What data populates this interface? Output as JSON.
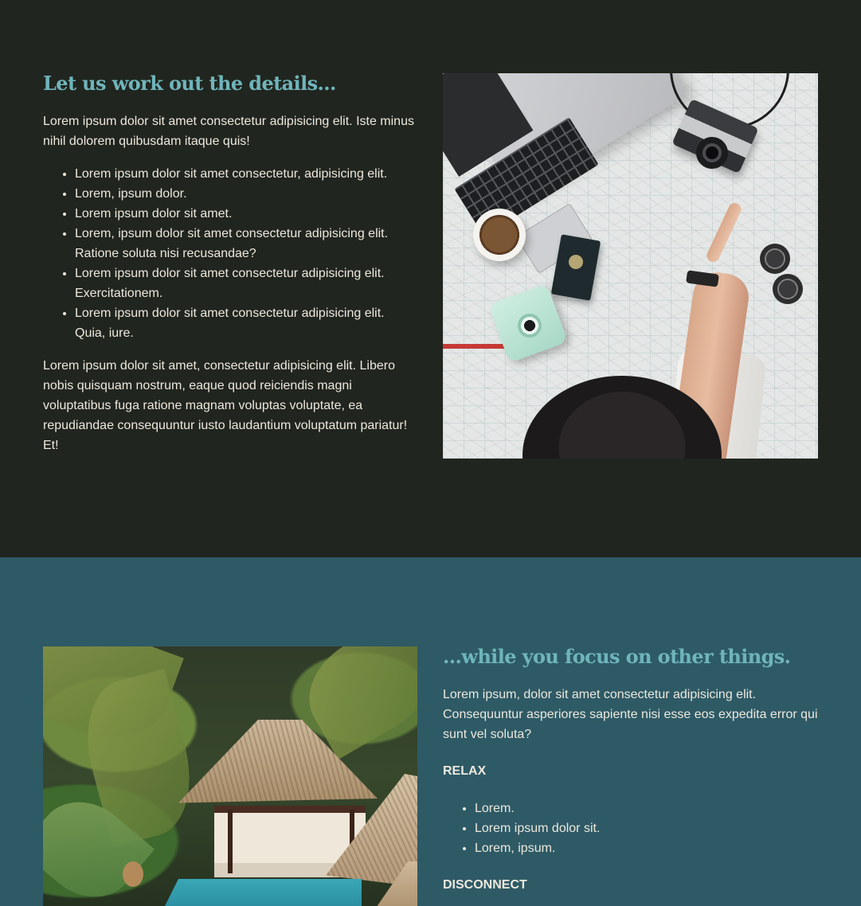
{
  "section_one": {
    "heading": "Let us work out the details...",
    "intro": "Lorem ipsum dolor sit amet consectetur adipisicing elit. Iste minus nihil dolorem quibusdam itaque quis!",
    "list": [
      "Lorem ipsum dolor sit amet consectetur, adipisicing elit.",
      "Lorem, ipsum dolor.",
      "Lorem ipsum dolor sit amet.",
      "Lorem, ipsum dolor sit amet consectetur adipisicing elit. Ratione soluta nisi recusandae?",
      "Lorem ipsum dolor sit amet consectetur adipisicing elit. Exercitationem.",
      "Lorem ipsum dolor sit amet consectetur adipisicing elit. Quia, iure."
    ],
    "outro": "Lorem ipsum dolor sit amet, consectetur adipisicing elit. Libero nobis quisquam nostrum, eaque quod reiciendis magni voluptatibus fuga ratione magnam voluptas voluptate, ea repudiandae consequuntur iusto laudantium voluptatum pariatur! Et!"
  },
  "section_two": {
    "heading": "...while you focus on other things.",
    "intro": "Lorem ipsum, dolor sit amet consectetur adipisicing elit. Consequuntur asperiores sapiente nisi esse eos expedita error qui sunt vel soluta?",
    "relax_label": "RELAX",
    "relax_list": [
      "Lorem.",
      "Lorem ipsum dolor sit.",
      "Lorem, ipsum."
    ],
    "disconnect_label": "DISCONNECT"
  },
  "colors": {
    "dark_background": "#21251f",
    "teal_background": "#2e5a66",
    "heading_accent": "#6fb5bb",
    "body_text": "#ece8dd"
  }
}
